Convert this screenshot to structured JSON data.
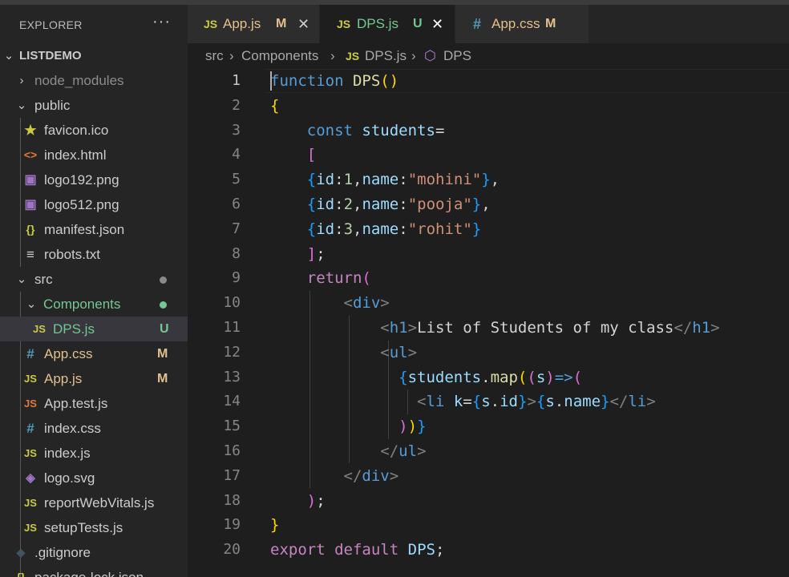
{
  "explorer": {
    "title": "EXPLORER",
    "more": "···",
    "root": "LISTDEMO",
    "items": [
      {
        "label": "node_modules",
        "chevron": "›"
      },
      {
        "label": "public",
        "chevron": "⌄"
      },
      {
        "label": "favicon.ico",
        "icon": "★"
      },
      {
        "label": "index.html",
        "icon": "<>"
      },
      {
        "label": "logo192.png",
        "icon": "▣"
      },
      {
        "label": "logo512.png",
        "icon": "▣"
      },
      {
        "label": "manifest.json",
        "icon": "{}"
      },
      {
        "label": "robots.txt",
        "icon": "≡"
      },
      {
        "label": "src",
        "chevron": "⌄"
      },
      {
        "label": "Components",
        "chevron": "⌄"
      },
      {
        "label": "DPS.js",
        "icon": "JS",
        "badge": "U"
      },
      {
        "label": "App.css",
        "icon": "#",
        "badge": "M"
      },
      {
        "label": "App.js",
        "icon": "JS",
        "badge": "M"
      },
      {
        "label": "App.test.js",
        "icon": "JS"
      },
      {
        "label": "index.css",
        "icon": "#"
      },
      {
        "label": "index.js",
        "icon": "JS"
      },
      {
        "label": "logo.svg",
        "icon": "◈"
      },
      {
        "label": "reportWebVitals.js",
        "icon": "JS"
      },
      {
        "label": "setupTests.js",
        "icon": "JS"
      },
      {
        "label": ".gitignore",
        "icon": "◆"
      },
      {
        "label": "package-lock.json",
        "icon": "{}"
      }
    ]
  },
  "tabs": [
    {
      "icon": "JS",
      "label": "App.js",
      "badge": "M",
      "close": "✕"
    },
    {
      "icon": "JS",
      "label": "DPS.js",
      "badge": "U",
      "close": "✕"
    },
    {
      "icon": "#",
      "label": "App.css",
      "badge": "M"
    }
  ],
  "breadcrumb": {
    "src": "src",
    "sep1": "›",
    "folder": "Components",
    "sep2": "›",
    "file_icon": "JS",
    "file": "DPS.js",
    "sep3": "›",
    "symbol_icon": "⬡",
    "symbol": "DPS"
  },
  "editor": {
    "line_numbers": [
      "1",
      "2",
      "3",
      "4",
      "5",
      "6",
      "7",
      "8",
      "9",
      "10",
      "11",
      "12",
      "13",
      "14",
      "15",
      "16",
      "17",
      "18",
      "19",
      "20"
    ],
    "active_line": "1"
  },
  "colors": {
    "js_icon": "#cbcb41",
    "css_icon": "#519aba",
    "modified": "#e2c08d",
    "untracked": "#73c991",
    "folder_green": "#73c991"
  }
}
